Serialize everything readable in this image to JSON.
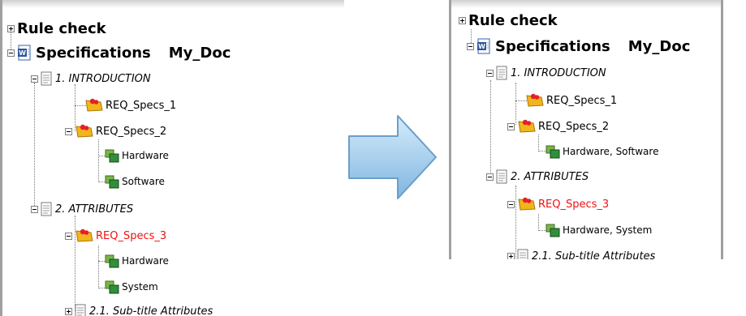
{
  "before": {
    "items": [
      {
        "type": "root",
        "label": "Rule check",
        "expander": "plus"
      },
      {
        "type": "doc",
        "label": "Specifications",
        "doc_name": "My_Doc",
        "expander": "minus"
      },
      {
        "type": "section",
        "label": "1. INTRODUCTION",
        "expander": "minus"
      },
      {
        "type": "requirement",
        "label": "REQ_Specs_1",
        "highlight": false
      },
      {
        "type": "requirement",
        "label": "REQ_Specs_2",
        "expander": "minus",
        "highlight": false
      },
      {
        "type": "attribute",
        "label": "Hardware"
      },
      {
        "type": "attribute",
        "label": "Software"
      },
      {
        "type": "section",
        "label": "2. ATTRIBUTES",
        "expander": "minus"
      },
      {
        "type": "requirement",
        "label": "REQ_Specs_3",
        "expander": "minus",
        "highlight": true
      },
      {
        "type": "attribute",
        "label": "Hardware"
      },
      {
        "type": "attribute",
        "label": "System"
      },
      {
        "type": "section",
        "label": "2.1. Sub-title Attributes",
        "expander": "plus"
      }
    ]
  },
  "after": {
    "items": [
      {
        "type": "root",
        "label": "Rule check",
        "expander": "plus"
      },
      {
        "type": "doc",
        "label": "Specifications",
        "doc_name": "My_Doc",
        "expander": "minus"
      },
      {
        "type": "section",
        "label": "1. INTRODUCTION",
        "expander": "minus"
      },
      {
        "type": "requirement",
        "label": "REQ_Specs_1",
        "highlight": false
      },
      {
        "type": "requirement",
        "label": "REQ_Specs_2",
        "expander": "minus",
        "highlight": false
      },
      {
        "type": "attribute",
        "label": "Hardware, Software"
      },
      {
        "type": "section",
        "label": "2. ATTRIBUTES",
        "expander": "minus"
      },
      {
        "type": "requirement",
        "label": "REQ_Specs_3",
        "expander": "minus",
        "highlight": true
      },
      {
        "type": "attribute",
        "label": "Hardware, System"
      },
      {
        "type": "section",
        "label": "2.1. Sub-title Attributes",
        "expander": "plus"
      }
    ]
  },
  "colors": {
    "highlight": "#ee1111",
    "arrow_light": "#d6ecfb",
    "arrow_dark": "#7fb5e0",
    "arrow_border": "#6b9fc9"
  },
  "icons": {
    "word": "word-doc-icon",
    "page": "page-icon",
    "requirement": "requirement-icon",
    "attribute": "attribute-icon",
    "arrow": "right-arrow-icon"
  }
}
